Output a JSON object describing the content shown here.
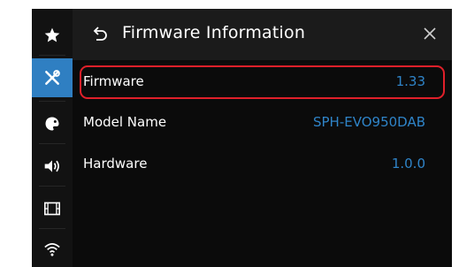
{
  "header": {
    "title": "Firmware Information"
  },
  "sidebar": {
    "items": [
      {
        "icon": "star-icon",
        "active": false
      },
      {
        "icon": "tools-icon",
        "active": true
      },
      {
        "icon": "palette-icon",
        "active": false
      },
      {
        "icon": "speaker-icon",
        "active": false
      },
      {
        "icon": "film-icon",
        "active": false
      },
      {
        "icon": "wifi-icon",
        "active": false
      }
    ]
  },
  "rows": [
    {
      "label": "Firmware",
      "value": "1.33",
      "highlighted": true
    },
    {
      "label": "Model Name",
      "value": "SPH-EVO950DAB",
      "highlighted": false
    },
    {
      "label": "Hardware",
      "value": "1.0.0",
      "highlighted": false
    }
  ],
  "colors": {
    "accent": "#2f7fc2",
    "value_text": "#2f84c8",
    "highlight_border": "#e0202a",
    "background": "#0b0b0b",
    "header_background": "#1b1b1b"
  }
}
